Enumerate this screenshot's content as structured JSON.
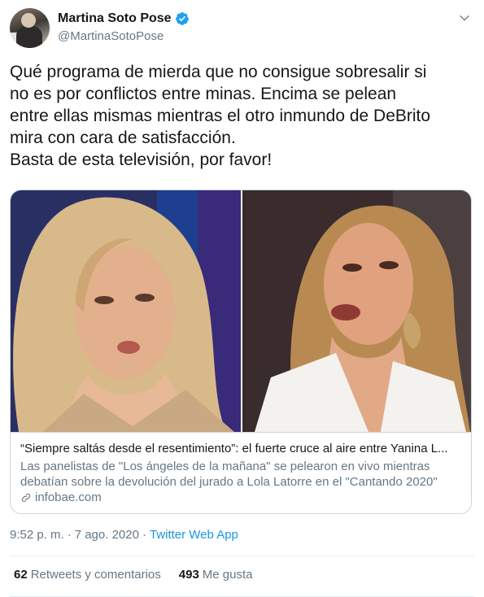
{
  "author": {
    "display_name": "Martina Soto Pose",
    "handle": "@MartinaSotoPose",
    "verified_color": "#1da1f2"
  },
  "tweet": {
    "text": "Qué programa de mierda que no consigue sobresalir si\nno es por conflictos entre minas. Encima se pelean\nentre ellas mismas mientras el otro inmundo de DeBrito\nmira con cara de satisfacción.\nBasta de esta televisión, por favor!"
  },
  "card": {
    "title": "“Siempre saltás desde el resentimiento”: el fuerte cruce al aire entre Yanina L...",
    "description": "Las panelistas de \"Los ángeles de la mañana\" se pelearon en vivo mientras debatían sobre la devolución del jurado a Lola Latorre en el \"Cantando 2020\"",
    "domain": "infobae.com"
  },
  "meta": {
    "time": "9:52 p. m.",
    "separator1": "·",
    "date": "7 ago. 2020",
    "separator2": "·",
    "app": "Twitter Web App"
  },
  "stats": {
    "retweets_count": "62",
    "retweets_label": "Retweets y comentarios",
    "likes_count": "493",
    "likes_label": "Me gusta"
  },
  "colors": {
    "link": "#1b95e0",
    "secondary_text": "#657786",
    "border": "#ccd6dd"
  }
}
